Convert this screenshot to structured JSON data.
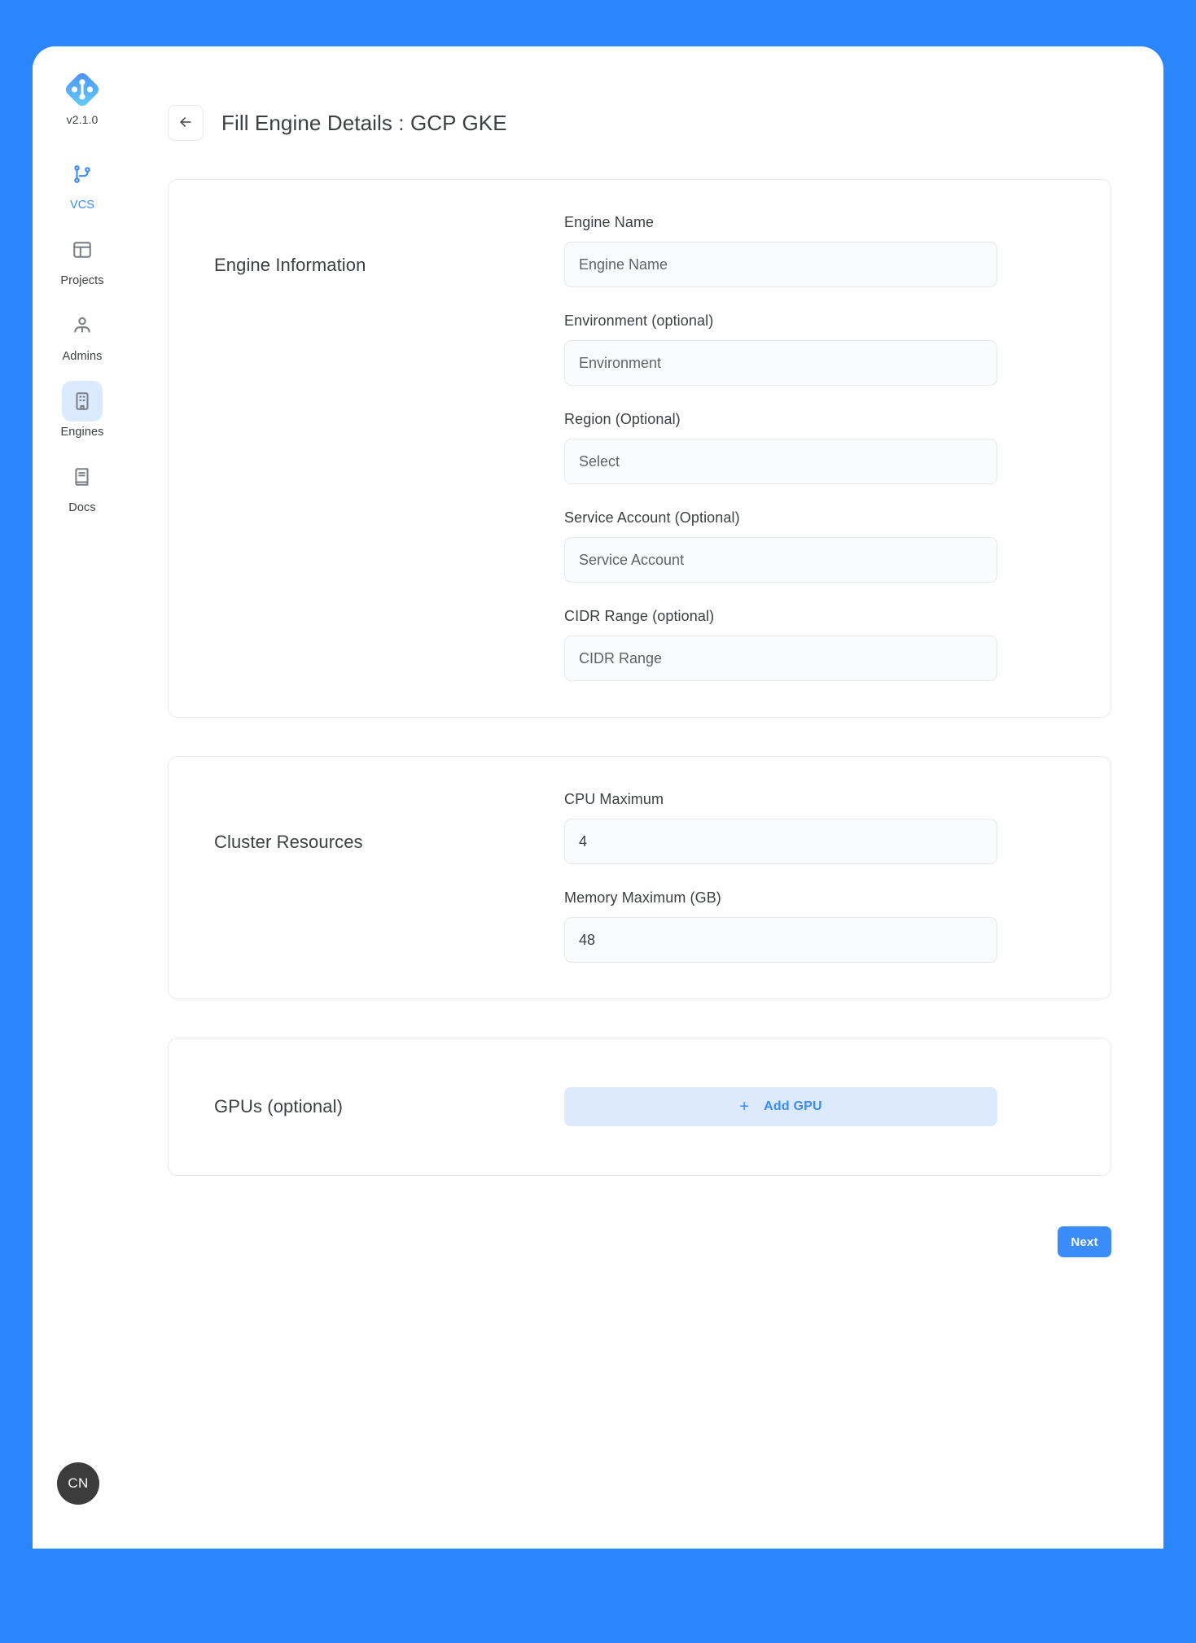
{
  "theme": {
    "page_background": "#2b85fb",
    "accent": "#3b8cfb",
    "accent_soft": "#ddeafd",
    "text": "#3c4043",
    "muted_text": "#5f6368",
    "field_background": "#fafbfc",
    "border": "#e8eaed",
    "avatar_background": "#3c3c3c"
  },
  "sidebar": {
    "version_label": "v2.1.0",
    "logo_icon": "brand-diamond-icon",
    "items": [
      {
        "label": "VCS",
        "icon": "branch-icon",
        "active": false,
        "current": true
      },
      {
        "label": "Projects",
        "icon": "layout-icon",
        "active": false,
        "current": false
      },
      {
        "label": "Admins",
        "icon": "users-icon",
        "active": false,
        "current": false
      },
      {
        "label": "Engines",
        "icon": "building-icon",
        "active": true,
        "current": false
      },
      {
        "label": "Docs",
        "icon": "book-icon",
        "active": false,
        "current": false
      }
    ],
    "avatar_initials": "CN"
  },
  "header": {
    "back_icon": "arrow-left-icon",
    "title": "Fill Engine Details : GCP GKE"
  },
  "cards": [
    {
      "title": "Engine Information",
      "fields": [
        {
          "label": "Engine Name",
          "placeholder": "Engine Name",
          "value": "",
          "type": "text"
        },
        {
          "label": "Environment (optional)",
          "placeholder": "Environment",
          "value": "",
          "type": "text"
        },
        {
          "label": "Region (Optional)",
          "placeholder": "Select",
          "value": "",
          "type": "select"
        },
        {
          "label": "Service Account (Optional)",
          "placeholder": "Service Account",
          "value": "",
          "type": "text"
        },
        {
          "label": "CIDR Range (optional)",
          "placeholder": "CIDR Range",
          "value": "",
          "type": "text"
        }
      ]
    },
    {
      "title": "Cluster Resources",
      "fields": [
        {
          "label": "CPU Maximum",
          "placeholder": "",
          "value": "4",
          "type": "text"
        },
        {
          "label": "Memory Maximum (GB)",
          "placeholder": "",
          "value": "48",
          "type": "text"
        }
      ]
    }
  ],
  "gpu_section": {
    "title": "GPUs (optional)",
    "add_button_label": "Add GPU",
    "add_button_icon": "plus-icon"
  },
  "footer": {
    "next_label": "Next"
  }
}
